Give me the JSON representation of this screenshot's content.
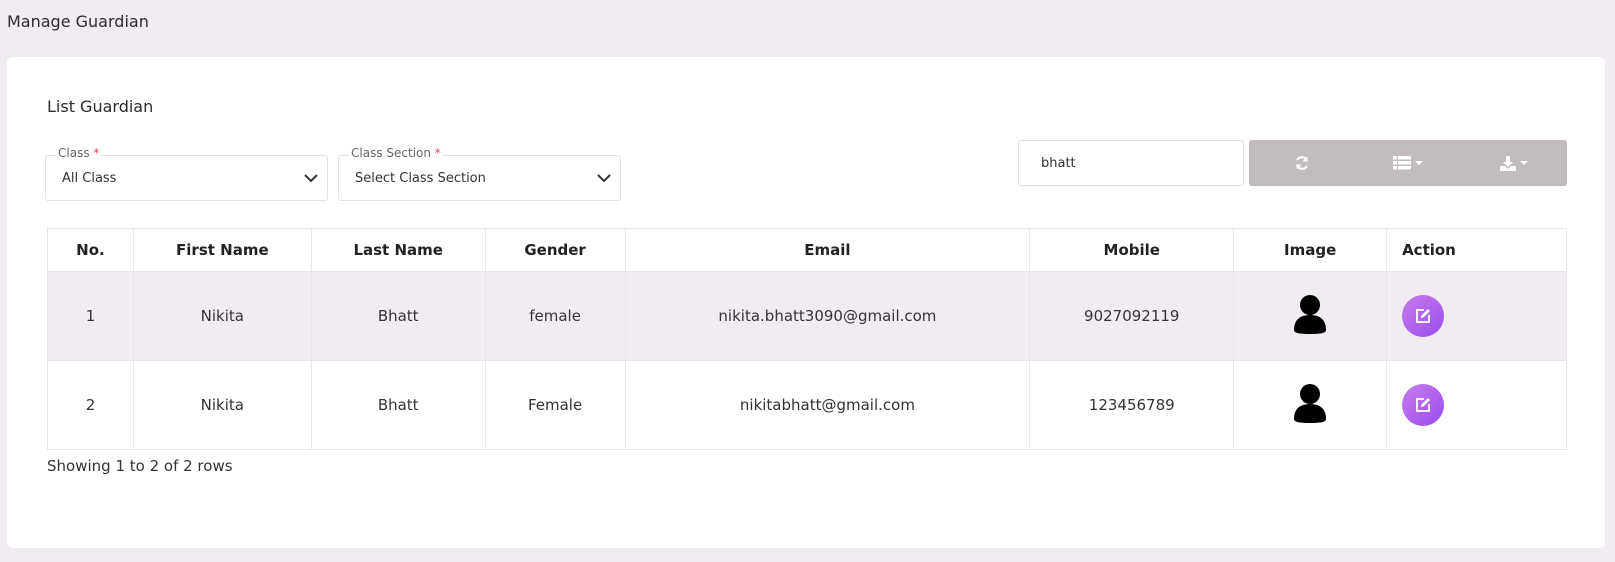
{
  "header": {
    "title": "Manage Guardian"
  },
  "card": {
    "title": "List Guardian"
  },
  "filters": {
    "class": {
      "label": "Class",
      "required_mark": "*",
      "value": "All Class"
    },
    "section": {
      "label": "Class Section",
      "required_mark": "*",
      "value": "Select Class Section"
    }
  },
  "toolbar": {
    "search_value": "bhatt",
    "refresh_icon": "refresh-icon",
    "columns_icon": "list-columns-icon",
    "export_icon": "download-icon"
  },
  "table": {
    "headers": [
      "No.",
      "First Name",
      "Last Name",
      "Gender",
      "Email",
      "Mobile",
      "Image",
      "Action"
    ],
    "rows": [
      {
        "no": "1",
        "first_name": "Nikita",
        "last_name": "Bhatt",
        "gender": "female",
        "email": "nikita.bhatt3090@gmail.com",
        "mobile": "9027092119"
      },
      {
        "no": "2",
        "first_name": "Nikita",
        "last_name": "Bhatt",
        "gender": "Female",
        "email": "nikitabhatt@gmail.com",
        "mobile": "123456789"
      }
    ]
  },
  "footer": {
    "pagination_info": "Showing 1 to 2 of 2 rows"
  },
  "colors": {
    "background": "#f1ecf2",
    "toolbar": "#c2bcbc",
    "accent_start": "#c77dea",
    "accent_end": "#9a4cf0",
    "required": "#e0475b"
  }
}
